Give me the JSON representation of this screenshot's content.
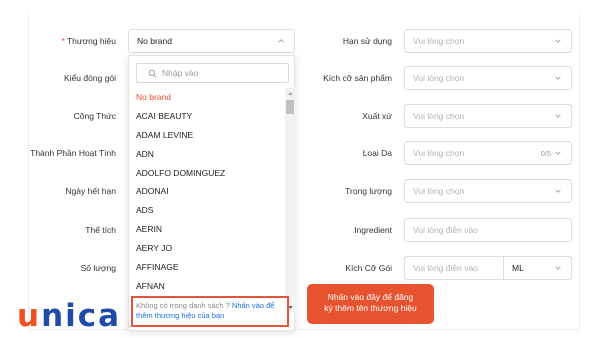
{
  "form": {
    "left_labels": {
      "brand": "Thương hiệu",
      "kieu_dong_goi": "Kiểu đóng gói",
      "cong_thuc": "Công Thức",
      "thanh_phan": "Thành Phần Hoạt Tính",
      "ngay_het_han": "Ngày hết hạn",
      "the_tich": "Thể tích",
      "so_luong": "Số lượng"
    },
    "brand_required_mark": "*",
    "brand_value": "No brand",
    "right_fields": [
      {
        "label": "Hạn sử dụng",
        "placeholder": "Vui lòng chọn"
      },
      {
        "label": "Kích cỡ sản phẩm",
        "placeholder": "Vui lòng chọn"
      },
      {
        "label": "Xuất xứ",
        "placeholder": "Vui lòng chọn"
      },
      {
        "label": "Loại Da",
        "placeholder": "Vui lòng chọn",
        "count": "0/5"
      },
      {
        "label": "Trọng lượng",
        "placeholder": "Vui lòng chọn"
      },
      {
        "label": "Ingredient",
        "placeholder": "Vui lòng điền vào"
      },
      {
        "label": "Kích Cỡ Gói",
        "placeholder": "Vui lòng điền vào",
        "unit": "ML"
      }
    ]
  },
  "dropdown": {
    "search_placeholder": "Nhập vào",
    "items": [
      "No brand",
      "ACAI BEAUTY",
      "ADAM LEVINE",
      "ADN",
      "ADOLFO DOMINGUEZ",
      "ADONAI",
      "ADS",
      "AERIN",
      "AERY JO",
      "AFFINAGE",
      "AFNAN"
    ],
    "footer_text": "Không có trong danh sách ? ",
    "footer_link": "Nhấn vào để thêm thương hiệu của bạn"
  },
  "callout": {
    "line1": "Nhấn vào đây để đăng",
    "line2": "ký thêm tên thương hiệu"
  },
  "logo": {
    "first_letter": "u",
    "rest": "nica"
  },
  "colors": {
    "accent": "#ee4d2d",
    "callout_bg": "#e8532f",
    "link": "#1a73e8",
    "logo_blue": "#1f4aa8",
    "logo_orange": "#f04e23"
  }
}
